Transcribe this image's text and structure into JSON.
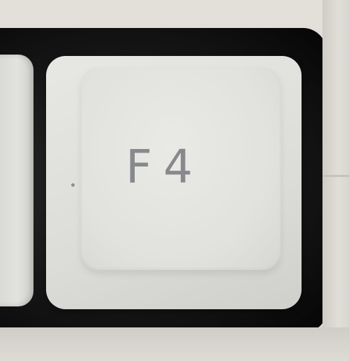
{
  "scene": {
    "description_key": "keyboard-keycap-closeup",
    "key": {
      "label": "F4"
    },
    "colors": {
      "keycap": "#e3e3df",
      "legend": "#7d7f84",
      "well": "#111111",
      "case": "#dcdad3"
    }
  }
}
